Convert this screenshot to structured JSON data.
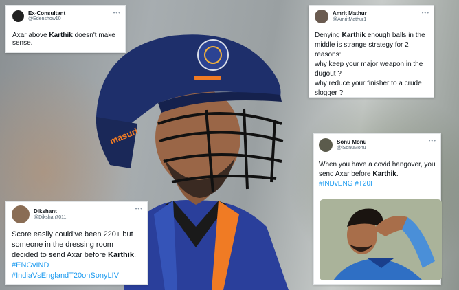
{
  "tweets": [
    {
      "name": "Ex-Consultant",
      "handle": "@Edenshow10",
      "text_before": "Axar above ",
      "highlight": "Karthik",
      "text_after": " doesn't make sense.",
      "more_icon": "ellipsis-icon"
    },
    {
      "name": "Amrit Mathur",
      "handle": "@AmritMathur1",
      "lines": [
        {
          "before": "Denying ",
          "highlight": "Karthik",
          "after": " enough balls in the"
        },
        {
          "before": "middle is strange strategy for 2",
          "highlight": "",
          "after": ""
        },
        {
          "before": "reasons:",
          "highlight": "",
          "after": ""
        },
        {
          "before": "why keep your major weapon in the",
          "highlight": "",
          "after": ""
        },
        {
          "before": "dugout ?",
          "highlight": "",
          "after": ""
        },
        {
          "before": "why reduce your finisher to  a crude",
          "highlight": "",
          "after": ""
        },
        {
          "before": "slogger ?",
          "highlight": "",
          "after": ""
        }
      ],
      "more_icon": "ellipsis-icon"
    },
    {
      "name": "Sonu Monu",
      "handle": "@iSonuMonu",
      "line1": "When you have a covid hangover, you",
      "line2_before": "send Axar before ",
      "line2_highlight": "Karthik",
      "line2_after": ".",
      "hashtags": "#INDvENG #T20I",
      "more_icon": "ellipsis-icon"
    },
    {
      "name": "Dikshant",
      "handle": "@Dikshan7011",
      "line1": "Score easily could've been 220+ but",
      "line2": "someone in the dressing room",
      "line3_before": "decided to send Axar before ",
      "line3_highlight": "Karthik",
      "line3_after": ".",
      "hashtag1": "#ENGvIND",
      "hashtag2": "#IndiaVsEnglandT20onSonyLIV",
      "more_icon": "ellipsis-icon"
    }
  ],
  "helmet_brand": "masuri",
  "colors": {
    "link": "#1d9bf0",
    "helmet": "#1e2f6b",
    "jersey": "#2a3f9b",
    "jersey_trim": "#f07b24"
  }
}
